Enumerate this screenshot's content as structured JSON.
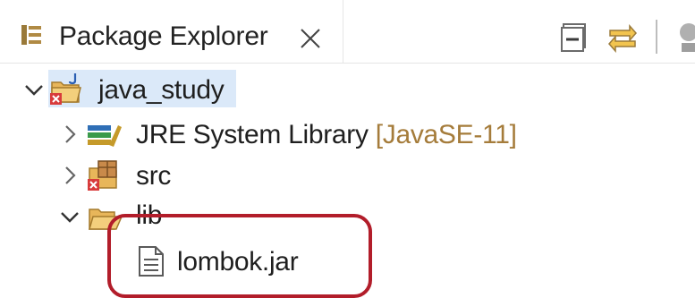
{
  "view": {
    "title": "Package Explorer",
    "tab_icon": "package-explorer-icon",
    "close_icon": "close-icon",
    "toolbar": {
      "collapse_all": "collapse-all-icon",
      "link_with_editor": "link-with-editor-icon",
      "view_menu": "view-menu-icon"
    }
  },
  "tree": {
    "project": {
      "label": "java_study",
      "icon": "java-project-error-icon",
      "expanded": true
    },
    "items": [
      {
        "label": "JRE System Library",
        "decoration": "[JavaSE-11]",
        "icon": "library-icon",
        "expanded": false
      },
      {
        "label": "src",
        "icon": "source-folder-error-icon",
        "expanded": false
      },
      {
        "label": "lib",
        "icon": "open-folder-icon",
        "expanded": true,
        "children": [
          {
            "label": "lombok.jar",
            "icon": "file-icon"
          }
        ]
      }
    ]
  },
  "colors": {
    "selection": "#dbe9f9",
    "highlight_box": "#b21d2a",
    "decoration_text": "#a57c3b",
    "error_badge": "#d83b3b",
    "folder": "#e8b65a"
  }
}
